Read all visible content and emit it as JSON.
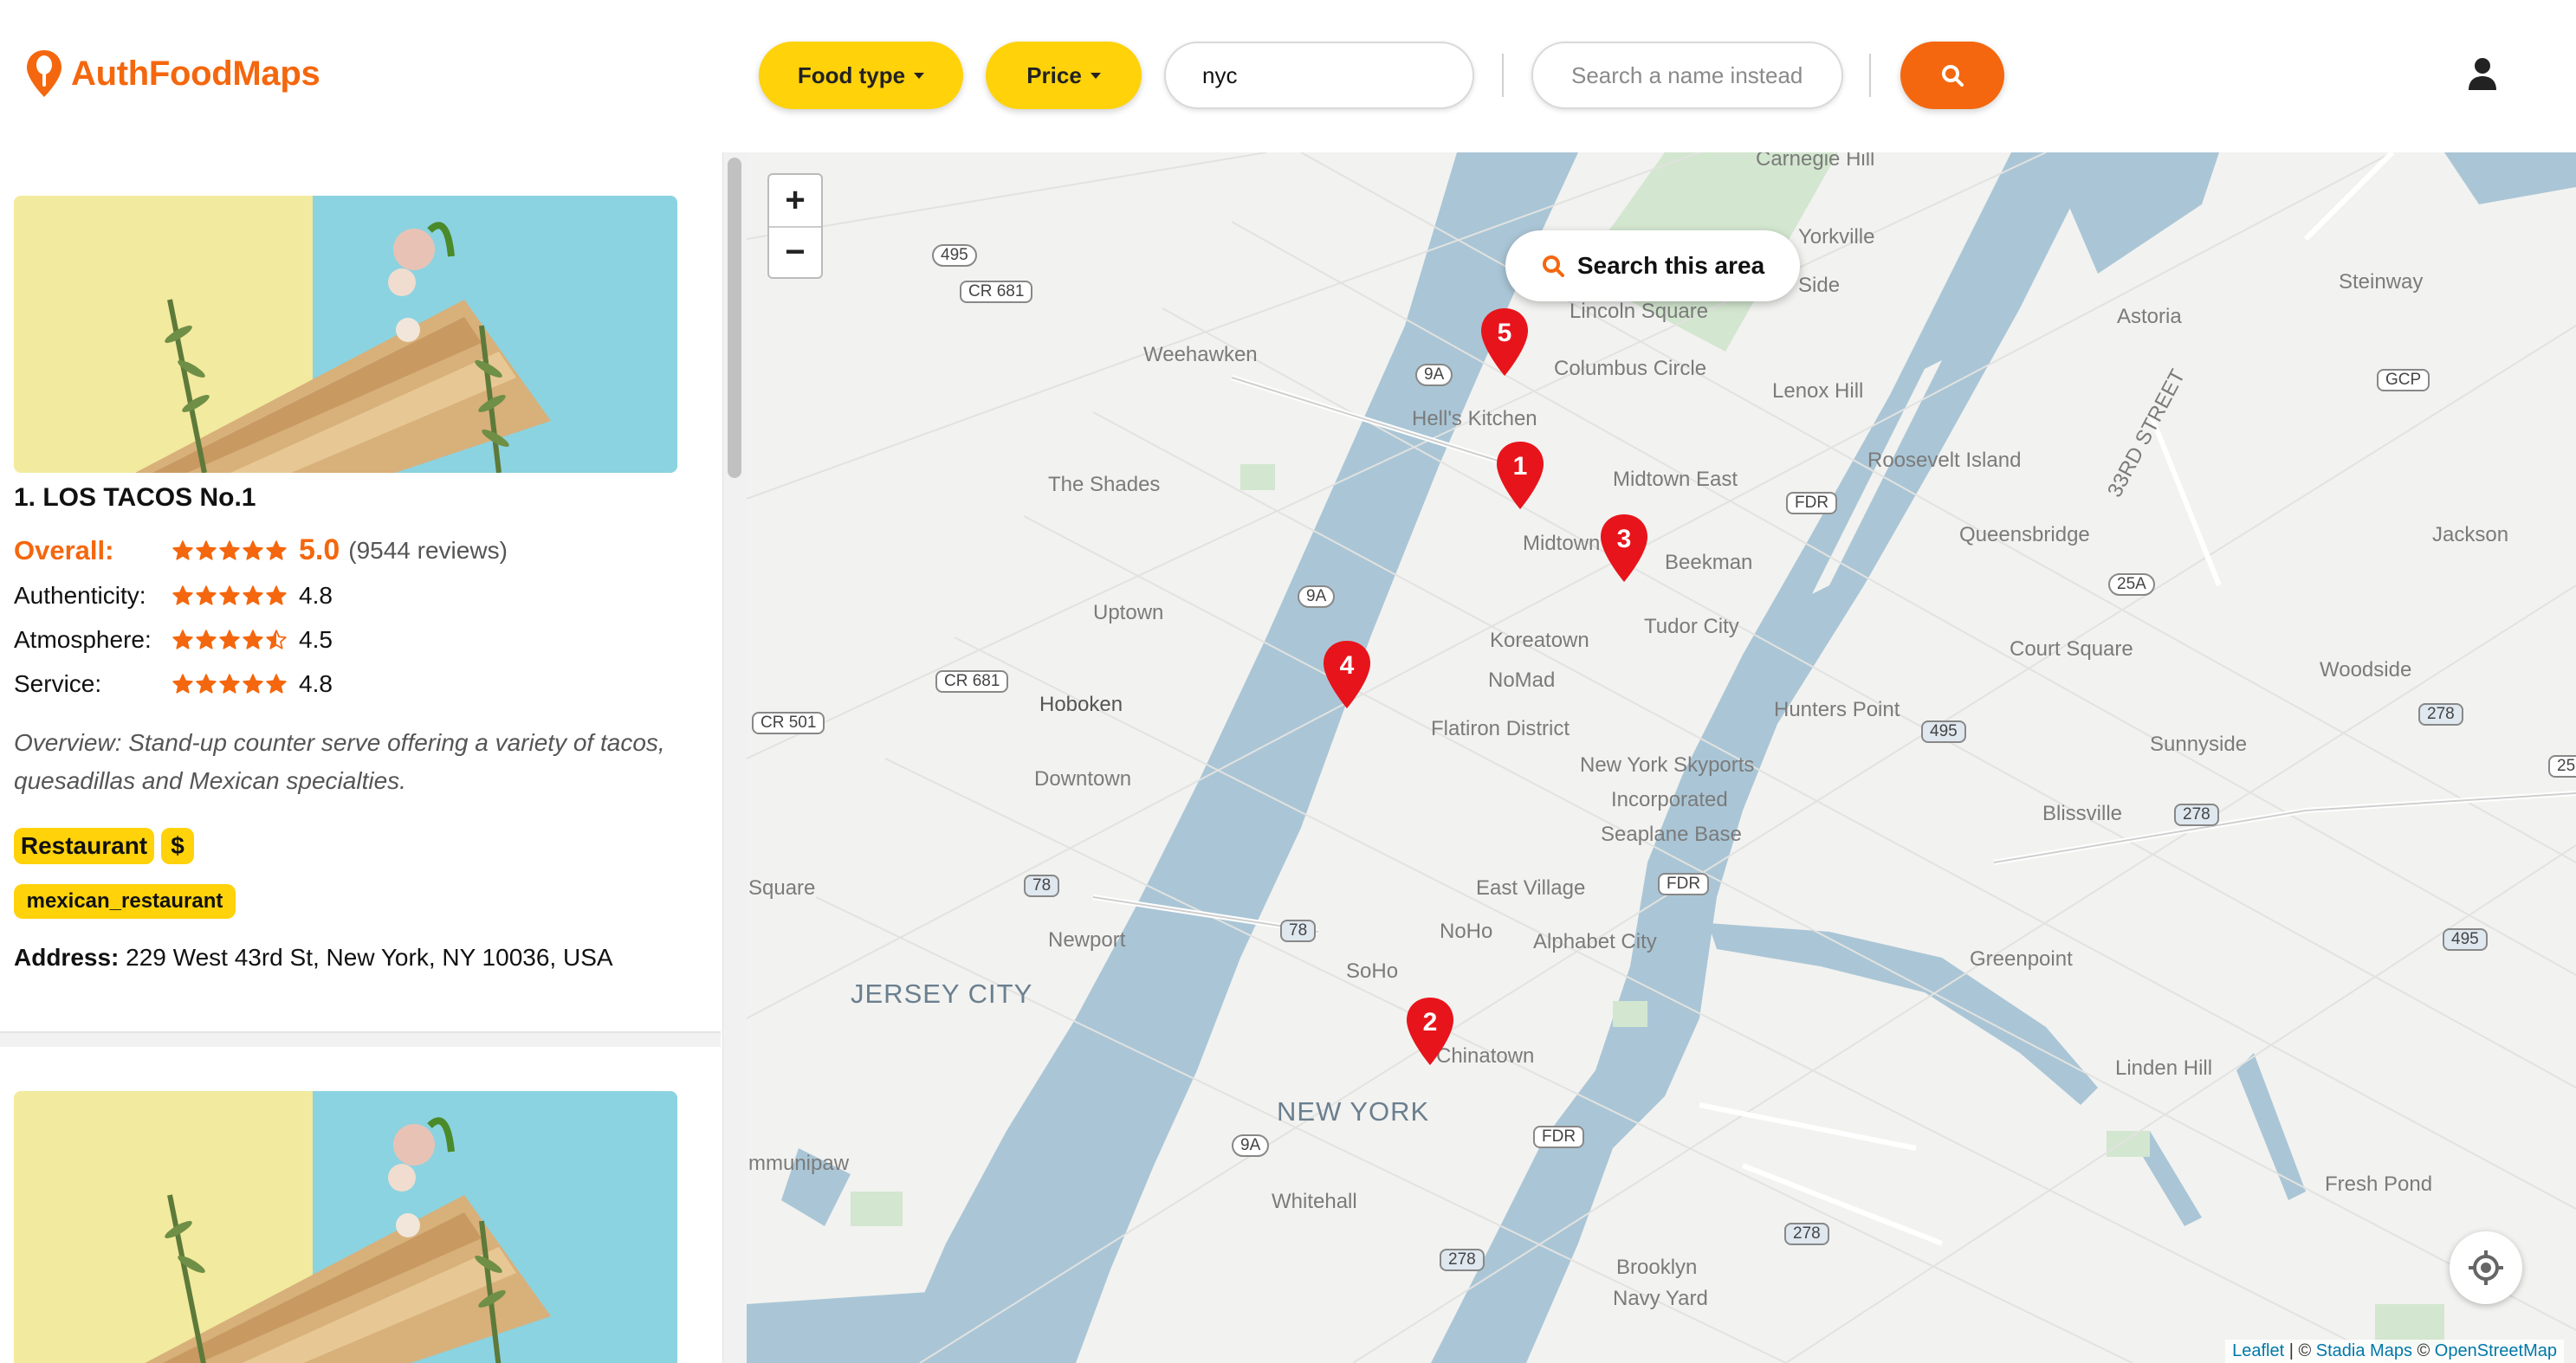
{
  "colors": {
    "brand": "#f4670e",
    "accent": "#ffd20a",
    "marker": "#e8141b",
    "water": "#aac6d6",
    "land": "#f2f2f0"
  },
  "header": {
    "app_name": "AuthFoodMaps",
    "logo_icon": "spoon-pin-icon",
    "food_type_label": "Food type",
    "price_label": "Price",
    "location_value": "nyc",
    "name_search_placeholder": "Search a name instead",
    "search_icon": "search-icon",
    "user_icon": "user-icon"
  },
  "results": [
    {
      "rank_title": "1. LOS TACOS No.1",
      "overall_label": "Overall:",
      "overall_score": "5.0",
      "overall_stars": 5.0,
      "reviews": "(9544 reviews)",
      "ratings": [
        {
          "label": "Authenticity:",
          "score": "4.8",
          "stars": 4.8
        },
        {
          "label": "Atmosphere:",
          "score": "4.5",
          "stars": 4.5
        },
        {
          "label": "Service:",
          "score": "4.8",
          "stars": 4.8
        }
      ],
      "overview": "Overview: Stand-up counter serve offering a variety of tacos, quesadillas and Mexican specialties.",
      "badges": [
        "Restaurant",
        "$"
      ],
      "tags": [
        "mexican_restaurant"
      ],
      "address_label": "Address:",
      "address": "229 West 43rd St, New York, NY 10036, USA"
    }
  ],
  "map": {
    "zoom_in": "+",
    "zoom_out": "−",
    "search_area_label": "Search this area",
    "markers": [
      "1",
      "2",
      "3",
      "4",
      "5"
    ],
    "labels": {
      "carnegie_hill": "Carnegie Hill",
      "yorkville": "Yorkville",
      "astoria": "Astoria",
      "steinway": "Steinway",
      "weehawken": "Weehawken",
      "lincoln_square": "Lincoln Square",
      "columbus_circle": "Columbus Circle",
      "upper_east_side": "Side",
      "lenox_hill": "Lenox Hill",
      "hells_kitchen": "Hell's Kitchen",
      "midtown_east": "Midtown East",
      "roosevelt_island": "Roosevelt Island",
      "the_shades": "The Shades",
      "midtown": "Midtown",
      "queensbridge": "Queensbridge",
      "33rd_street": "33RD STREET",
      "jackson": "Jackson",
      "beekman": "Beekman",
      "uptown": "Uptown",
      "tudor_city": "Tudor City",
      "koreatown": "Koreatown",
      "court_square": "Court Square",
      "woodside": "Woodside",
      "nomad": "NoMad",
      "hoboken": "Hoboken",
      "hunters_point": "Hunters Point",
      "flatiron": "Flatiron District",
      "sunnyside": "Sunnyside",
      "downtown": "Downtown",
      "skyports_1": "New York Skyports",
      "skyports_2": "Incorporated",
      "skyports_3": "Seaplane Base",
      "blissville": "Blissville",
      "square": "Square",
      "east_village": "East Village",
      "newport": "Newport",
      "noho": "NoHo",
      "alphabet_city": "Alphabet City",
      "jersey_city": "JERSEY CITY",
      "greenpoint": "Greenpoint",
      "soho": "SoHo",
      "chinatown": "Chinatown",
      "linden_hill": "Linden Hill",
      "new_york": "NEW YORK",
      "communipaw": "mmunipaw",
      "whitehall": "Whitehall",
      "fresh_pond": "Fresh Pond",
      "brooklyn_navy_1": "Brooklyn",
      "brooklyn_navy_2": "Navy Yard"
    },
    "shields": {
      "s495a": "495",
      "cr681a": "CR 681",
      "s9a_1": "9A",
      "gcp": "GCP",
      "fdr1": "FDR",
      "s25a": "25A",
      "s9a_2": "9A",
      "cr681b": "CR 681",
      "cr501": "CR 501",
      "s495b": "495",
      "s278a": "278",
      "s278b": "278",
      "s78a": "78",
      "s78b": "78",
      "fdr2": "FDR",
      "s495c": "495",
      "s9a_3": "9A",
      "fdr3": "FDR",
      "s278c": "278",
      "s278d": "278",
      "s25": "25"
    },
    "attribution": {
      "leaflet": "Leaflet",
      "sep1": " | © ",
      "stadia": "Stadia Maps",
      "sep2": " © ",
      "osm": "OpenStreetMap"
    }
  }
}
